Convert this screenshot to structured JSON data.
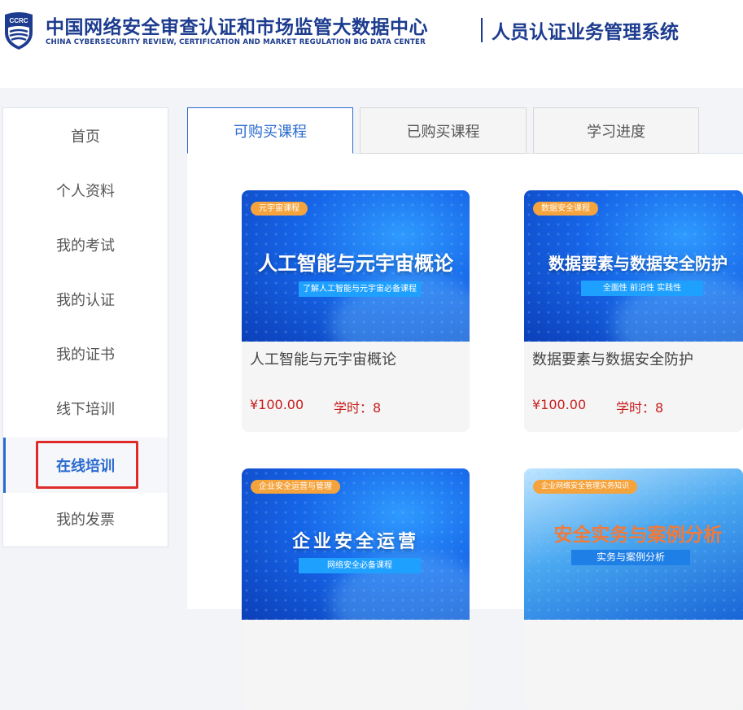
{
  "header": {
    "logo_text": "CCRC",
    "org_name_cn": "中国网络安全审查认证和市场监管大数据中心",
    "org_name_en": "CHINA CYBERSECURITY REVIEW, CERTIFICATION AND MARKET REGULATION BIG DATA CENTER",
    "system_title": "人员认证业务管理系统"
  },
  "sidebar": {
    "items": [
      {
        "label": "首页"
      },
      {
        "label": "个人资料"
      },
      {
        "label": "我的考试"
      },
      {
        "label": "我的认证"
      },
      {
        "label": "我的证书"
      },
      {
        "label": "线下培训"
      },
      {
        "label": "在线培训",
        "active": true
      },
      {
        "label": "我的发票"
      }
    ],
    "highlight_color": "#e02b2b"
  },
  "tabs": [
    {
      "label": "可购买课程",
      "active": true
    },
    {
      "label": "已购买课程"
    },
    {
      "label": "学习进度"
    }
  ],
  "courses": [
    {
      "tag": "元宇宙课程",
      "cover_title": "人工智能与元宇宙概论",
      "cover_subtitle": "了解人工智能与元宇宙必备课程",
      "name": "人工智能与元宇宙概论",
      "price": "¥100.00",
      "hours": "学时：8"
    },
    {
      "tag": "数据安全课程",
      "cover_title": "数据要素与数据安全防护",
      "cover_subtitle": "全面性  前沿性  实践性",
      "name": "数据要素与数据安全防护",
      "price": "¥100.00",
      "hours": "学时：8"
    },
    {
      "tag": "企业安全运营与管理",
      "cover_title": "企业安全运营",
      "cover_subtitle": "网络安全必备课程"
    },
    {
      "tag": "企业网络安全管理实务知识",
      "cover_title": "安全实务与案例分析",
      "cover_subtitle": "实务与案例分析"
    }
  ],
  "colors": {
    "brand": "#1d3c8f",
    "accent": "#2a6ad0",
    "price": "#c81d1d",
    "tag": "#f5a33c"
  }
}
